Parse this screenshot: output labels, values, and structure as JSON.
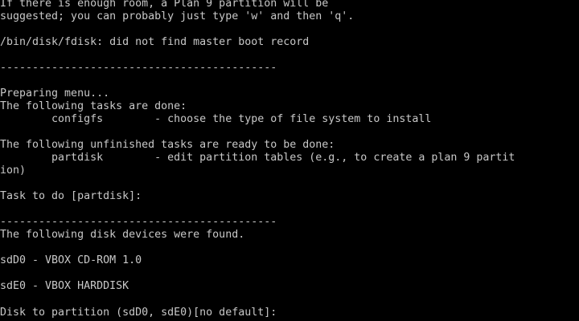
{
  "colors": {
    "background": "#000000",
    "text": "#c8c8c8"
  },
  "console": {
    "intro_line_1": "If there is enough room, a Plan 9 partition will be",
    "intro_line_2": "suggested; you can probably just type 'w' and then 'q'.",
    "fdisk_message": "/bin/disk/fdisk: did not find master boot record",
    "separator_1": "-------------------------------------------",
    "preparing_menu": "Preparing menu...",
    "done_header": "The following tasks are done:",
    "done_task_configfs": "        configfs        - choose the type of file system to install",
    "ready_header": "The following unfinished tasks are ready to be done:",
    "ready_task_partdisk": "        partdisk        - edit partition tables (e.g., to create a plan 9 partit",
    "ready_task_partdisk_wrap": "ion)",
    "task_prompt": "Task to do [partdisk]:",
    "separator_2": "-------------------------------------------",
    "devices_header": "The following disk devices were found.",
    "device_sdD0": "sdD0 - VBOX CD-ROM 1.0",
    "device_sdE0": "sdE0 - VBOX HARDDISK",
    "partition_prompt": "Disk to partition (sdD0, sdE0)[no default]: "
  }
}
